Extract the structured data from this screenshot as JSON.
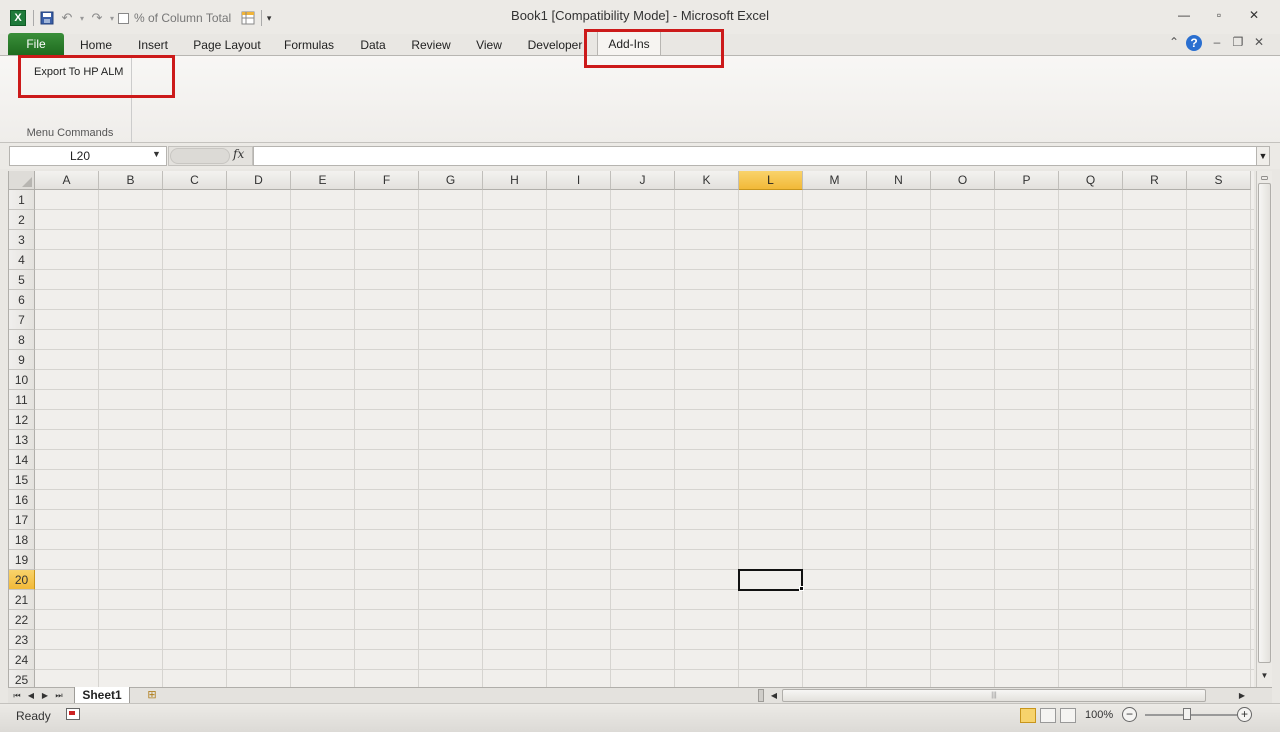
{
  "app": {
    "title": "Book1  [Compatibility Mode]  -  Microsoft Excel",
    "qat_label": "% of Column Total"
  },
  "tabs": [
    "File",
    "Home",
    "Insert",
    "Page Layout",
    "Formulas",
    "Data",
    "Review",
    "View",
    "Developer",
    "Add-Ins"
  ],
  "active_tab": "Add-Ins",
  "ribbon": {
    "button_label": "Export To HP ALM",
    "group_label": "Menu Commands"
  },
  "formula_bar": {
    "name_box": "L20",
    "fx_label": "fx",
    "formula_value": ""
  },
  "grid": {
    "columns": [
      "A",
      "B",
      "C",
      "D",
      "E",
      "F",
      "G",
      "H",
      "I",
      "J",
      "K",
      "L",
      "M",
      "N",
      "O",
      "P",
      "Q",
      "R",
      "S"
    ],
    "rows": [
      "1",
      "2",
      "3",
      "4",
      "5",
      "6",
      "7",
      "8",
      "9",
      "10",
      "11",
      "12",
      "13",
      "14",
      "15",
      "16",
      "17",
      "18",
      "19",
      "20",
      "21",
      "22",
      "23",
      "24",
      "25"
    ],
    "selected_column": "L",
    "selected_row": "20"
  },
  "sheets": [
    "Sheet1"
  ],
  "status": {
    "ready": "Ready",
    "zoom": "100%"
  },
  "colors": {
    "file_tab": "#2f7f2f",
    "highlight": "#cc1a1a",
    "selected_header": "#f4c04c"
  }
}
